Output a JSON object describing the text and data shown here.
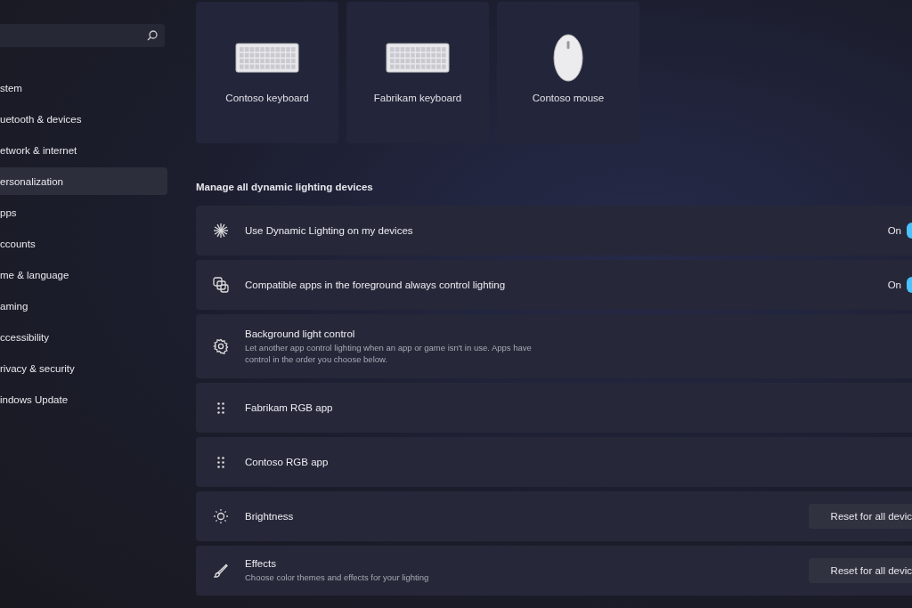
{
  "sidebar": {
    "items": [
      {
        "label": "stem",
        "selected": false
      },
      {
        "label": "uetooth & devices",
        "selected": false
      },
      {
        "label": "etwork & internet",
        "selected": false
      },
      {
        "label": "ersonalization",
        "selected": true
      },
      {
        "label": "pps",
        "selected": false
      },
      {
        "label": "ccounts",
        "selected": false
      },
      {
        "label": "me & language",
        "selected": false
      },
      {
        "label": "aming",
        "selected": false
      },
      {
        "label": "ccessibility",
        "selected": false
      },
      {
        "label": "rivacy & security",
        "selected": false
      },
      {
        "label": "indows Update",
        "selected": false
      }
    ]
  },
  "devices": [
    {
      "kind": "keyboard",
      "name": "Contoso keyboard"
    },
    {
      "kind": "keyboard",
      "name": "Fabrikam keyboard"
    },
    {
      "kind": "mouse",
      "name": "Contoso mouse"
    }
  ],
  "section_title": "Manage all dynamic lighting devices",
  "settings": [
    {
      "kind": "toggle",
      "title": "Use Dynamic Lighting on my devices",
      "state_label": "On",
      "on": true
    },
    {
      "kind": "toggle",
      "title": "Compatible apps in the foreground always control lighting",
      "state_label": "On",
      "on": true
    },
    {
      "kind": "info",
      "title": "Background light control",
      "description": "Let another app control lighting when an app or game isn't in use. Apps have control in the order you choose below."
    },
    {
      "kind": "drag",
      "title": "Fabrikam RGB app"
    },
    {
      "kind": "drag",
      "title": "Contoso RGB app"
    },
    {
      "kind": "button",
      "title": "Brightness",
      "button": "Reset for all devic"
    },
    {
      "kind": "button",
      "title": "Effects",
      "description": "Choose color themes and effects for your lighting",
      "button": "Reset for all devic"
    }
  ]
}
